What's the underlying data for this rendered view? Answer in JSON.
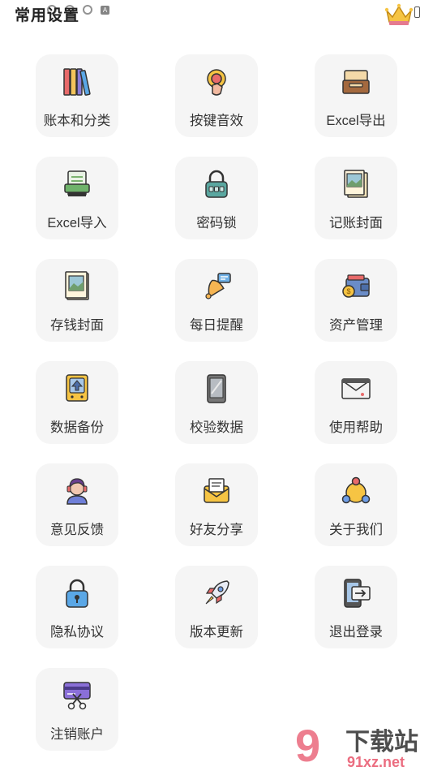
{
  "header": {
    "title": "常用设置"
  },
  "menu": {
    "items": [
      {
        "label": "账本和分类",
        "icon": "books-icon"
      },
      {
        "label": "按键音效",
        "icon": "press-button-icon"
      },
      {
        "label": "Excel导出",
        "icon": "file-tray-icon"
      },
      {
        "label": "Excel导入",
        "icon": "xls-file-icon"
      },
      {
        "label": "密码锁",
        "icon": "padlock-icon"
      },
      {
        "label": "记账封面",
        "icon": "picture-stack-icon"
      },
      {
        "label": "存钱封面",
        "icon": "photo-icon"
      },
      {
        "label": "每日提醒",
        "icon": "bell-icon"
      },
      {
        "label": "资产管理",
        "icon": "wallet-icon"
      },
      {
        "label": "数据备份",
        "icon": "backup-drive-icon"
      },
      {
        "label": "校验数据",
        "icon": "tablet-icon"
      },
      {
        "label": "使用帮助",
        "icon": "envelope-icon"
      },
      {
        "label": "意见反馈",
        "icon": "support-agent-icon"
      },
      {
        "label": "好友分享",
        "icon": "mail-share-icon"
      },
      {
        "label": "关于我们",
        "icon": "network-circle-icon"
      },
      {
        "label": "隐私协议",
        "icon": "lock-icon"
      },
      {
        "label": "版本更新",
        "icon": "rocket-icon"
      },
      {
        "label": "退出登录",
        "icon": "logout-icon"
      },
      {
        "label": "注销账户",
        "icon": "cut-card-icon"
      }
    ]
  },
  "watermark": {
    "text": "下载站",
    "sub": "91xz.net"
  }
}
